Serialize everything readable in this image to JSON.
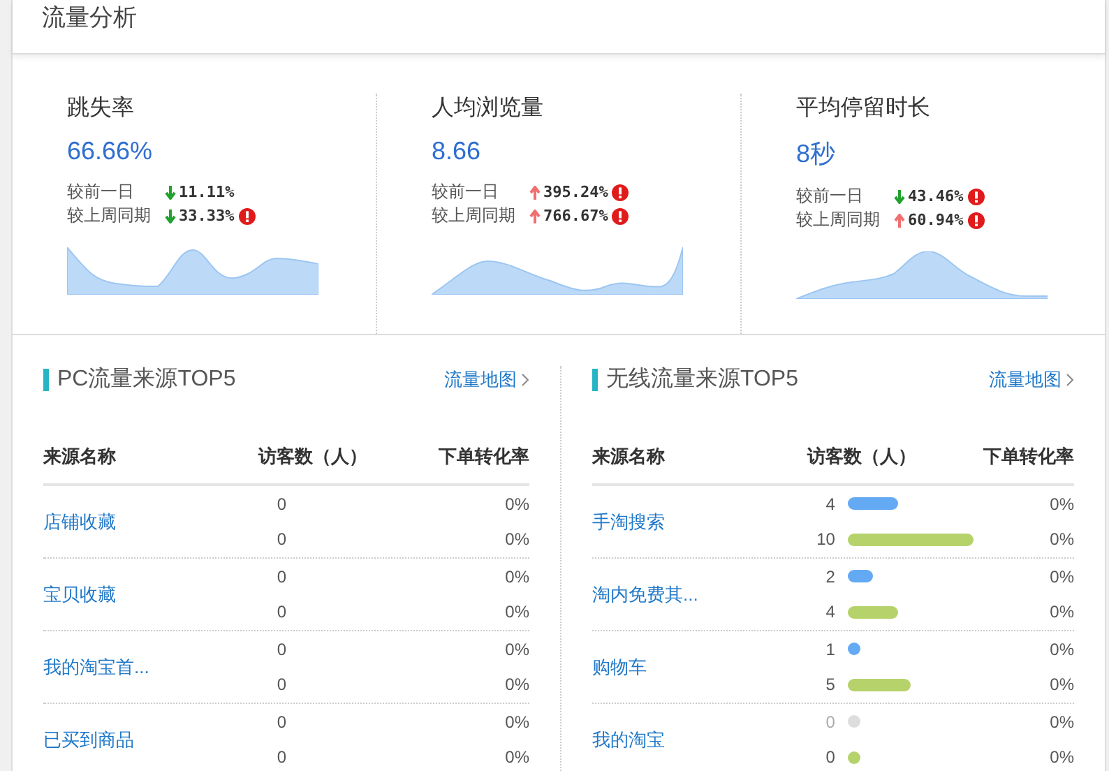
{
  "header": {
    "title": "流量分析"
  },
  "metrics": [
    {
      "label": "跳失率",
      "value": "66.66%",
      "comparisons": [
        {
          "label": "较前一日",
          "rising": false,
          "change": "11.11%",
          "warning": false
        },
        {
          "label": "较上周同期",
          "rising": false,
          "change": "33.33%",
          "warning": true
        }
      ]
    },
    {
      "label": "人均浏览量",
      "value": "8.66",
      "comparisons": [
        {
          "label": "较前一日",
          "rising": true,
          "change": "395.24%",
          "warning": true
        },
        {
          "label": "较上周同期",
          "rising": true,
          "change": "766.67%",
          "warning": true
        }
      ]
    },
    {
      "label": "平均停留时长",
      "value": "8秒",
      "comparisons": [
        {
          "label": "较前一日",
          "rising": false,
          "change": "43.46%",
          "warning": true
        },
        {
          "label": "较上周同期",
          "rising": true,
          "change": "60.94%",
          "warning": true
        }
      ]
    }
  ],
  "panels": [
    {
      "title": "PC流量来源TOP5",
      "link": "流量地图",
      "columns": [
        "来源名称",
        "访客数（人）",
        "下单转化率"
      ],
      "rows": [
        {
          "name": "店铺收藏",
          "lines": [
            {
              "kind": "plain",
              "visitors": "0",
              "rate": "0%"
            },
            {
              "kind": "plain",
              "visitors": "0",
              "rate": "0%"
            }
          ]
        },
        {
          "name": "宝贝收藏",
          "lines": [
            {
              "kind": "plain",
              "visitors": "0",
              "rate": "0%"
            },
            {
              "kind": "plain",
              "visitors": "0",
              "rate": "0%"
            }
          ]
        },
        {
          "name": "我的淘宝首...",
          "lines": [
            {
              "kind": "plain",
              "visitors": "0",
              "rate": "0%"
            },
            {
              "kind": "plain",
              "visitors": "0",
              "rate": "0%"
            }
          ]
        },
        {
          "name": "已买到商品",
          "lines": [
            {
              "kind": "plain",
              "visitors": "0",
              "rate": "0%"
            },
            {
              "kind": "plain",
              "visitors": "0",
              "rate": "0%"
            }
          ]
        }
      ]
    },
    {
      "title": "无线流量来源TOP5",
      "link": "流量地图",
      "columns": [
        "来源名称",
        "访客数（人）",
        "下单转化率"
      ],
      "rows": [
        {
          "name": "手淘搜索",
          "lines": [
            {
              "kind": "bar",
              "visitors": "4",
              "color": "#63a9f4",
              "dim": false,
              "rate": "0%"
            },
            {
              "kind": "bar",
              "visitors": "10",
              "color": "#b6d36b",
              "dim": false,
              "rate": "0%"
            }
          ]
        },
        {
          "name": "淘内免费其...",
          "lines": [
            {
              "kind": "bar",
              "visitors": "2",
              "color": "#63a9f4",
              "dim": false,
              "rate": "0%"
            },
            {
              "kind": "bar",
              "visitors": "4",
              "color": "#b6d36b",
              "dim": false,
              "rate": "0%"
            }
          ]
        },
        {
          "name": "购物车",
          "lines": [
            {
              "kind": "bar",
              "visitors": "1",
              "color": "#63a9f4",
              "dim": false,
              "rate": "0%"
            },
            {
              "kind": "bar",
              "visitors": "5",
              "color": "#b6d36b",
              "dim": false,
              "rate": "0%"
            }
          ]
        },
        {
          "name": "我的淘宝",
          "lines": [
            {
              "kind": "bar",
              "visitors": "0",
              "color": "#dddddd",
              "dim": true,
              "rate": "0%"
            },
            {
              "kind": "bar",
              "visitors": "0",
              "color": "#b6d36b",
              "dim": false,
              "rate": "0%"
            }
          ]
        }
      ]
    }
  ]
}
